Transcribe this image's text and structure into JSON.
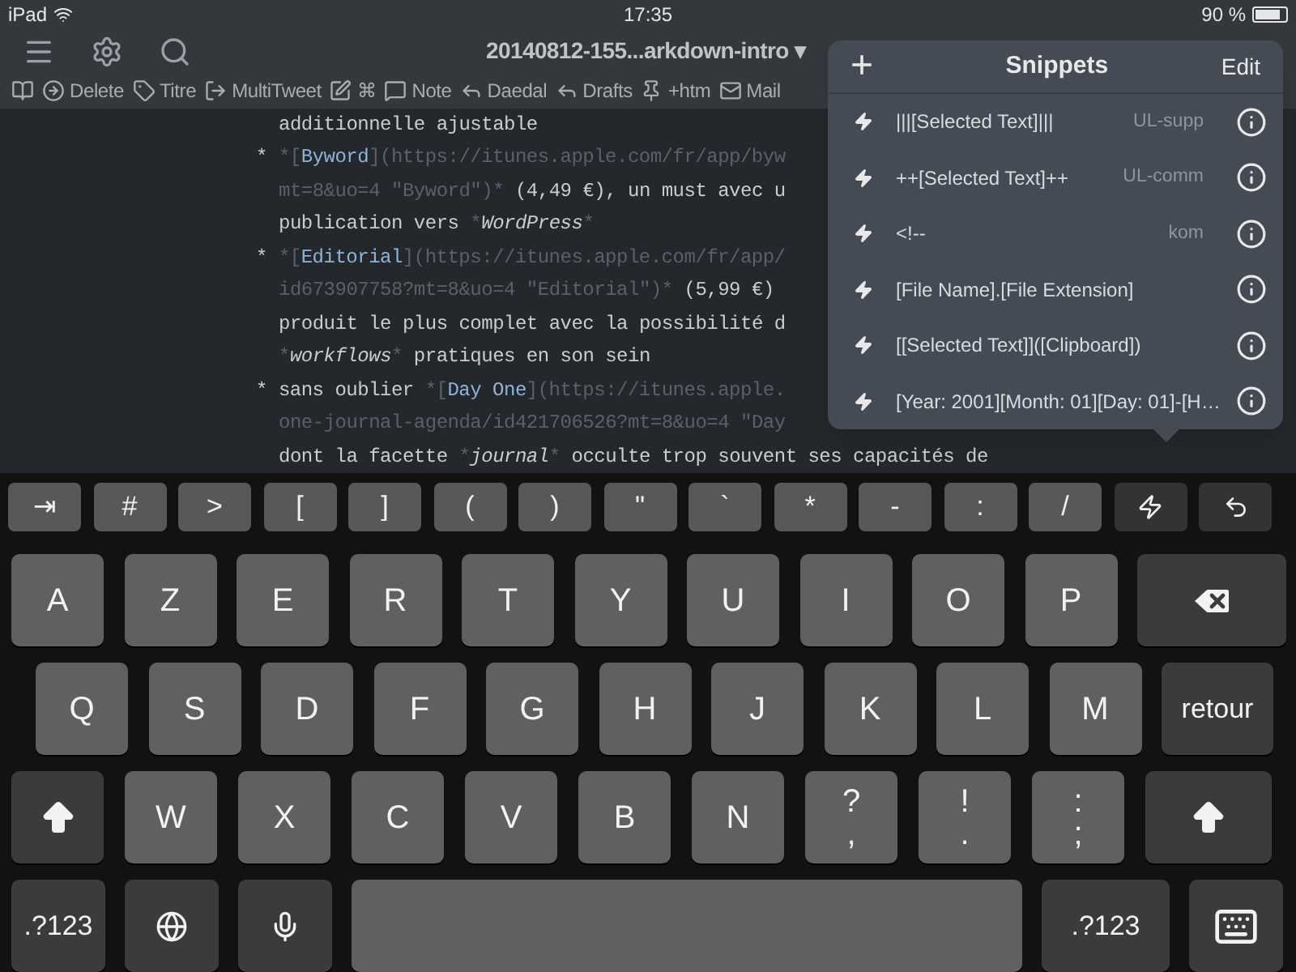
{
  "status_bar": {
    "device": "iPad",
    "time": "17:35",
    "battery": "90 %"
  },
  "nav": {
    "title": "20140812-155...arkdown-intro",
    "caret": "▾"
  },
  "toolbar": [
    {
      "kind": "book"
    },
    {
      "kind": "circle-arrow",
      "label": "Delete"
    },
    {
      "kind": "tag",
      "label": "Titre"
    },
    {
      "kind": "export",
      "label": "MultiTweet"
    },
    {
      "kind": "edit",
      "label": "⌘"
    },
    {
      "kind": "bubble",
      "label": "Note"
    },
    {
      "kind": "reply",
      "label": "Daedal"
    },
    {
      "kind": "reply",
      "label": "Drafts"
    },
    {
      "kind": "pin",
      "label": "+htm"
    },
    {
      "kind": "mail",
      "label": "Mail"
    }
  ],
  "editor": {
    "lines": [
      [
        {
          "kind": "text",
          "text": "additionnelle ajustable"
        }
      ],
      [
        {
          "kind": "bullet",
          "text": "*"
        },
        {
          "kind": "mark",
          "text": "*["
        },
        {
          "kind": "link",
          "text": "Byword"
        },
        {
          "kind": "url",
          "text": "](https://itunes.apple.com/fr/app/byw"
        }
      ],
      [
        {
          "kind": "url",
          "text": "mt=8&uo=4 \"Byword\")*"
        },
        {
          "kind": "text",
          "text": " (4,49 €), un must avec u"
        }
      ],
      [
        {
          "kind": "text",
          "text": "publication vers "
        },
        {
          "kind": "mark",
          "text": "*"
        },
        {
          "kind": "italic",
          "text": "WordPress"
        },
        {
          "kind": "mark",
          "text": "*"
        }
      ],
      [
        {
          "kind": "bullet",
          "text": "*"
        },
        {
          "kind": "mark",
          "text": "*["
        },
        {
          "kind": "link",
          "text": "Editorial"
        },
        {
          "kind": "url",
          "text": "](https://itunes.apple.com/fr/app/"
        }
      ],
      [
        {
          "kind": "url",
          "text": "id673907758?mt=8&uo=4 \"Editorial\")*"
        },
        {
          "kind": "text",
          "text": " (5,99 €)"
        }
      ],
      [
        {
          "kind": "text",
          "text": "produit le plus complet avec la possibilité d"
        }
      ],
      [
        {
          "kind": "mark",
          "text": "*"
        },
        {
          "kind": "italic",
          "text": "workflows"
        },
        {
          "kind": "mark",
          "text": "*"
        },
        {
          "kind": "text",
          "text": " pratiques en son sein"
        }
      ],
      [
        {
          "kind": "bullet",
          "text": "*"
        },
        {
          "kind": "text",
          "text": "sans oublier "
        },
        {
          "kind": "mark",
          "text": "*["
        },
        {
          "kind": "link",
          "text": "Day One"
        },
        {
          "kind": "url",
          "text": "](https://itunes.apple."
        }
      ],
      [
        {
          "kind": "url",
          "text": "one-journal-agenda/id421706526?mt=8&uo=4 \"Day"
        }
      ],
      [
        {
          "kind": "text",
          "text": "dont la facette "
        },
        {
          "kind": "mark",
          "text": "*"
        },
        {
          "kind": "italic",
          "text": "journal"
        },
        {
          "kind": "mark",
          "text": "*"
        },
        {
          "kind": "text",
          "text": " occulte trop souvent ses capacités de"
        }
      ]
    ]
  },
  "snippets": {
    "add": "+",
    "title": "Snippets",
    "edit": "Edit",
    "items": [
      {
        "text": "|||[Selected Text]|||",
        "abbrev": "UL-supp"
      },
      {
        "text": "++[Selected Text]++",
        "abbrev": "UL-comm"
      },
      {
        "text": "<!--",
        "abbrev": "kom"
      },
      {
        "text": "[File Name].[File Extension]"
      },
      {
        "text": "[[Selected Text]]([Clipboard])"
      },
      {
        "text": "[Year: 2001][Month: 01][Day: 01]-[H…"
      }
    ]
  },
  "keyboard": {
    "accessory": [
      {
        "kind": "char",
        "label": "⇥"
      },
      {
        "kind": "char",
        "label": "#"
      },
      {
        "kind": "char",
        "label": ">"
      },
      {
        "kind": "char",
        "label": "["
      },
      {
        "kind": "char",
        "label": "]"
      },
      {
        "kind": "char",
        "label": "("
      },
      {
        "kind": "char",
        "label": ")"
      },
      {
        "kind": "char",
        "label": "\""
      },
      {
        "kind": "char",
        "label": "`"
      },
      {
        "kind": "char",
        "label": "*"
      },
      {
        "kind": "char",
        "label": "-"
      },
      {
        "kind": "char",
        "label": ":"
      },
      {
        "kind": "char",
        "label": "/"
      },
      {
        "kind": "snippets"
      },
      {
        "kind": "undo"
      }
    ],
    "rows": [
      {
        "keys": [
          {
            "kind": "letter",
            "label": "A"
          },
          {
            "kind": "letter",
            "label": "Z"
          },
          {
            "kind": "letter",
            "label": "E"
          },
          {
            "kind": "letter",
            "label": "R"
          },
          {
            "kind": "letter",
            "label": "T"
          },
          {
            "kind": "letter",
            "label": "Y"
          },
          {
            "kind": "letter",
            "label": "U"
          },
          {
            "kind": "letter",
            "label": "I"
          },
          {
            "kind": "letter",
            "label": "O"
          },
          {
            "kind": "letter",
            "label": "P"
          },
          {
            "kind": "backspace"
          }
        ]
      },
      {
        "keys": [
          {
            "kind": "letter",
            "label": "Q"
          },
          {
            "kind": "letter",
            "label": "S"
          },
          {
            "kind": "letter",
            "label": "D"
          },
          {
            "kind": "letter",
            "label": "F"
          },
          {
            "kind": "letter",
            "label": "G"
          },
          {
            "kind": "letter",
            "label": "H"
          },
          {
            "kind": "letter",
            "label": "J"
          },
          {
            "kind": "letter",
            "label": "K"
          },
          {
            "kind": "letter",
            "label": "L"
          },
          {
            "kind": "letter",
            "label": "M"
          },
          {
            "kind": "return",
            "label": "retour"
          }
        ]
      },
      {
        "keys": [
          {
            "kind": "shift"
          },
          {
            "kind": "letter",
            "label": "W"
          },
          {
            "kind": "letter",
            "label": "X"
          },
          {
            "kind": "letter",
            "label": "C"
          },
          {
            "kind": "letter",
            "label": "V"
          },
          {
            "kind": "letter",
            "label": "B"
          },
          {
            "kind": "letter",
            "label": "N"
          },
          {
            "kind": "dual",
            "label": "?",
            "sub": ","
          },
          {
            "kind": "dual",
            "label": "!",
            "sub": "."
          },
          {
            "kind": "dual",
            "label": ":",
            "sub": ";"
          },
          {
            "kind": "shift"
          }
        ]
      },
      {
        "keys": [
          {
            "kind": "numbers",
            "label": ".?123"
          },
          {
            "kind": "globe"
          },
          {
            "kind": "mic"
          },
          {
            "kind": "space"
          },
          {
            "kind": "numbers",
            "label": ".?123"
          },
          {
            "kind": "hide"
          }
        ]
      }
    ]
  }
}
